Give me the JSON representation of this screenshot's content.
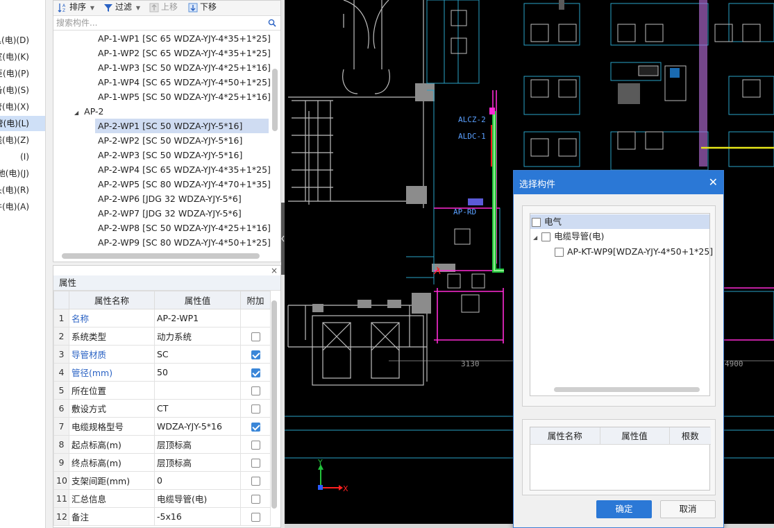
{
  "left_nav": {
    "items": [
      {
        "label": "具(电)(D)",
        "active": false
      },
      {
        "label": "室(电)(K)",
        "active": false
      },
      {
        "label": "巨(电)(P)",
        "active": false
      },
      {
        "label": "备(电)(S)",
        "active": false
      },
      {
        "label": "管(电)(X)",
        "active": false
      },
      {
        "label": "管(电)(L)",
        "active": true
      },
      {
        "label": "线(电)(Z)",
        "active": false
      },
      {
        "label": "(I)",
        "active": false
      },
      {
        "label": "地(电)(J)",
        "active": false
      },
      {
        "label": "头(电)(R)",
        "active": false
      },
      {
        "label": "件(电)(A)",
        "active": false
      }
    ]
  },
  "toolbar": {
    "sort_label": "排序",
    "filter_label": "过滤",
    "move_up_label": "上移",
    "move_down_label": "下移"
  },
  "search": {
    "placeholder": "搜索构件..."
  },
  "tree": {
    "group_label": "AP-2",
    "items_before": [
      "AP-1-WP1 [SC 65 WDZA-YJY-4*35+1*25]",
      "AP-1-WP2 [SC 65 WDZA-YJY-4*35+1*25]",
      "AP-1-WP3 [SC 50 WDZA-YJY-4*25+1*16]",
      "AP-1-WP4 [SC 65 WDZA-YJY-4*50+1*25]",
      "AP-1-WP5 [SC 50 WDZA-YJY-4*25+1*16]"
    ],
    "items_after": [
      "AP-2-WP1 [SC 50 WDZA-YJY-5*16]",
      "AP-2-WP2 [SC 50 WDZA-YJY-5*16]",
      "AP-2-WP3 [SC 50 WDZA-YJY-5*16]",
      "AP-2-WP4 [SC 65 WDZA-YJY-4*35+1*25]",
      "AP-2-WP5 [SC 80 WDZA-YJY-4*70+1*35]",
      "AP-2-WP6 [JDG 32 WDZA-YJY-5*6]",
      "AP-2-WP7 [JDG 32 WDZA-YJY-5*6]",
      "AP-2-WP8 [SC 50 WDZA-YJY-4*25+1*16]",
      "AP-2-WP9 [SC 80 WDZA-YJY-4*50+1*25]"
    ]
  },
  "properties": {
    "title": "属性",
    "close_label": "×",
    "headers": {
      "name": "属性名称",
      "value": "属性值",
      "extra": "附加"
    },
    "rows": [
      {
        "num": "1",
        "name": "名称",
        "value": "AP-2-WP1",
        "blue": true,
        "checkbox": false,
        "checked": false
      },
      {
        "num": "2",
        "name": "系统类型",
        "value": "动力系统",
        "blue": false,
        "checkbox": true,
        "checked": false
      },
      {
        "num": "3",
        "name": "导管材质",
        "value": "SC",
        "blue": true,
        "checkbox": true,
        "checked": true
      },
      {
        "num": "4",
        "name": "管径(mm)",
        "value": "50",
        "blue": true,
        "checkbox": true,
        "checked": true
      },
      {
        "num": "5",
        "name": "所在位置",
        "value": "",
        "blue": false,
        "checkbox": true,
        "checked": false
      },
      {
        "num": "6",
        "name": "敷设方式",
        "value": "CT",
        "blue": false,
        "checkbox": true,
        "checked": false
      },
      {
        "num": "7",
        "name": "电缆规格型号",
        "value": "WDZA-YJY-5*16",
        "blue": false,
        "checkbox": true,
        "checked": true
      },
      {
        "num": "8",
        "name": "起点标高(m)",
        "value": "层顶标高",
        "blue": false,
        "checkbox": true,
        "checked": false
      },
      {
        "num": "9",
        "name": "终点标高(m)",
        "value": "层顶标高",
        "blue": false,
        "checkbox": true,
        "checked": false
      },
      {
        "num": "10",
        "name": "支架间距(mm)",
        "value": "0",
        "blue": false,
        "checkbox": true,
        "checked": false
      },
      {
        "num": "11",
        "name": "汇总信息",
        "value": "电缆导管(电)",
        "blue": false,
        "checkbox": true,
        "checked": false
      },
      {
        "num": "12",
        "name": "备注",
        "value": "-5x16",
        "blue": false,
        "checkbox": true,
        "checked": false
      }
    ]
  },
  "cad": {
    "labels": {
      "alcz": "ALCZ-2",
      "aldc": "ALDC-1",
      "apr": "AP-RD",
      "dim1": "3130",
      "dim2": "4900",
      "axis_x": "X",
      "axis_y": "Y"
    },
    "colors": {
      "background": "#000000",
      "wall": "#bfbfbf",
      "room": "#2aa3c9",
      "highlight": "#ff2bd6",
      "pipe": "#23c23c",
      "yellow": "#e8e81a"
    }
  },
  "dialog": {
    "title": "选择构件",
    "close_label": "✕",
    "tree": {
      "root": "电气",
      "child": "电缆导管(电)",
      "leaf": "AP-KT-WP9[WDZA-YJY-4*50+1*25]"
    },
    "table_headers": {
      "name": "属性名称",
      "value": "属性值",
      "count": "根数"
    },
    "ok_label": "确定",
    "cancel_label": "取消"
  }
}
